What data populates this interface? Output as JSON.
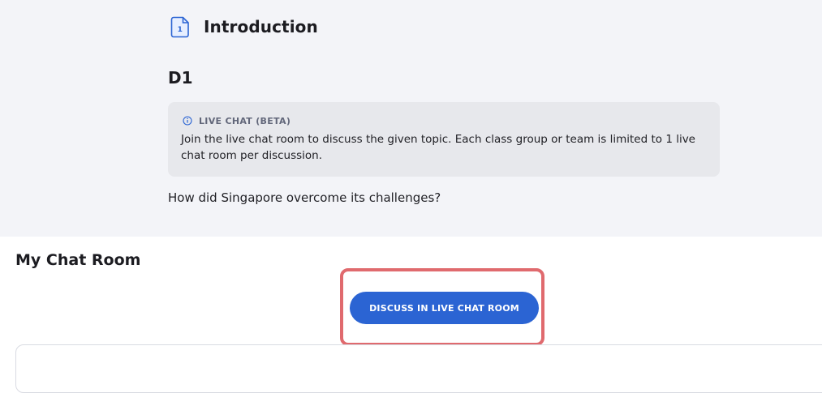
{
  "section": {
    "title": "Introduction",
    "icon": "document-number-icon",
    "icon_number": "1"
  },
  "discussion": {
    "title": "D1",
    "info": {
      "icon": "info-icon",
      "label": "LIVE CHAT (BETA)",
      "text": "Join the live chat room to discuss the given topic. Each class group or team is limited to 1 live chat room per discussion."
    },
    "question": "How did Singapore overcome its challenges?"
  },
  "chat_room": {
    "title": "My Chat Room",
    "button_label": "DISCUSS IN LIVE CHAT ROOM"
  },
  "colors": {
    "top_background": "#f3f4f8",
    "info_box": "#e7e8ec",
    "button": "#2b64d3",
    "highlight": "#e06a6e",
    "icon_blue": "#2b64d3"
  }
}
